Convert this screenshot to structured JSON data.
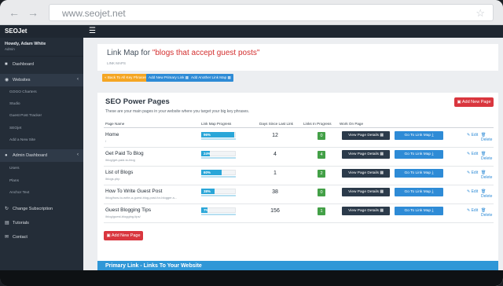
{
  "browser": {
    "url": "www.seojet.net"
  },
  "app": {
    "logo": "SEOJet"
  },
  "sidebar": {
    "user_name": "Howdy, Adam White",
    "user_role": "Admin",
    "items": [
      {
        "label": "Dashboard",
        "icon": "dashboard-icon"
      },
      {
        "label": "Websites",
        "icon": "globe-icon",
        "chevron": true
      },
      {
        "label": "Admin Dashboard",
        "icon": "admin-icon",
        "chevron": true
      },
      {
        "label": "Change Subscription",
        "icon": "refresh-icon"
      },
      {
        "label": "Tutorials",
        "icon": "book-icon"
      },
      {
        "label": "Contact",
        "icon": "chat-icon"
      }
    ],
    "website_subitems": [
      "GOGO Charters",
      "Studio",
      "Guest Post Tracker",
      "SEOjet",
      "Add a New Site"
    ],
    "admin_subitems": [
      "Users",
      "Plans",
      "Anchor Text"
    ]
  },
  "page": {
    "title_prefix": "Link Map for",
    "title_keyword": "\"blogs that accept guest posts\"",
    "subtitle": "LINK MAPS",
    "buttons": [
      {
        "label": "Back To All Key Phrases",
        "color": "#f5a623"
      },
      {
        "label": "Add New Primary Link",
        "color": "#2e8bd6"
      },
      {
        "label": "Add Another Link Map",
        "color": "#2e8bd6"
      }
    ]
  },
  "panel": {
    "title": "SEO Power Pages",
    "description": "These are your main pages in your website where you target your big key phrases.",
    "add_label": "Add New Page",
    "headers": [
      "Page Name",
      "Link Map Progress",
      "Days Since Last Link",
      "Links In Progress",
      "Work On Page"
    ],
    "view_label": "View Page Details",
    "goto_label": "Go To Link Map",
    "edit_label": "Edit",
    "delete_label": "Delete",
    "rows": [
      {
        "name": "Home",
        "url": "/",
        "progress": 96,
        "progress_label": "96%",
        "days": "12",
        "links": "0"
      },
      {
        "name": "Get Paid To Blog",
        "url": "/blog/get-paid-to-blog",
        "progress": 24,
        "progress_label": "24%",
        "days": "4",
        "links": "4"
      },
      {
        "name": "List of Blogs",
        "url": "/blogs.php",
        "progress": 60,
        "progress_label": "60%",
        "days": "1",
        "links": "2"
      },
      {
        "name": "How To Write Guest Post",
        "url": "/blog/how-to-write-a-guest-blog-post-for-blogger-s...",
        "progress": 38,
        "progress_label": "38%",
        "days": "38",
        "links": "0"
      },
      {
        "name": "Guest Blogging Tips",
        "url": "/blog/guest-blogging-tips/",
        "progress": 7,
        "progress_label": "7%",
        "days": "156",
        "links": "1"
      }
    ]
  },
  "primary_links": {
    "title": "Primary Link - Links To Your Website"
  }
}
